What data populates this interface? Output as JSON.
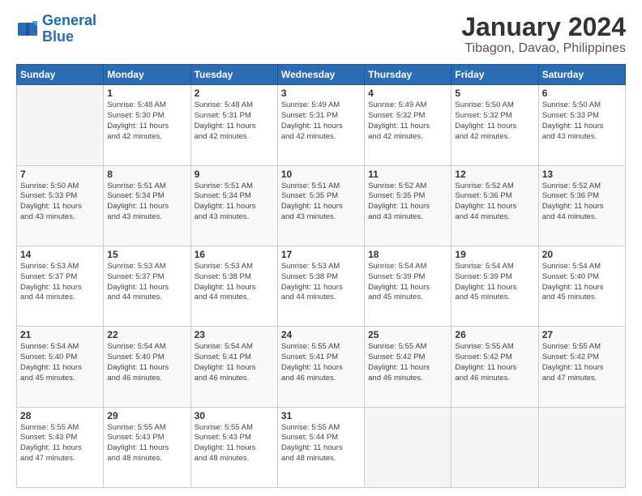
{
  "header": {
    "logo_line1": "General",
    "logo_line2": "Blue",
    "title": "January 2024",
    "subtitle": "Tibagon, Davao, Philippines"
  },
  "weekdays": [
    "Sunday",
    "Monday",
    "Tuesday",
    "Wednesday",
    "Thursday",
    "Friday",
    "Saturday"
  ],
  "weeks": [
    [
      {
        "day": "",
        "info": ""
      },
      {
        "day": "1",
        "info": "Sunrise: 5:48 AM\nSunset: 5:30 PM\nDaylight: 11 hours\nand 42 minutes."
      },
      {
        "day": "2",
        "info": "Sunrise: 5:48 AM\nSunset: 5:31 PM\nDaylight: 11 hours\nand 42 minutes."
      },
      {
        "day": "3",
        "info": "Sunrise: 5:49 AM\nSunset: 5:31 PM\nDaylight: 11 hours\nand 42 minutes."
      },
      {
        "day": "4",
        "info": "Sunrise: 5:49 AM\nSunset: 5:32 PM\nDaylight: 11 hours\nand 42 minutes."
      },
      {
        "day": "5",
        "info": "Sunrise: 5:50 AM\nSunset: 5:32 PM\nDaylight: 11 hours\nand 42 minutes."
      },
      {
        "day": "6",
        "info": "Sunrise: 5:50 AM\nSunset: 5:33 PM\nDaylight: 11 hours\nand 43 minutes."
      }
    ],
    [
      {
        "day": "7",
        "info": "Sunrise: 5:50 AM\nSunset: 5:33 PM\nDaylight: 11 hours\nand 43 minutes."
      },
      {
        "day": "8",
        "info": "Sunrise: 5:51 AM\nSunset: 5:34 PM\nDaylight: 11 hours\nand 43 minutes."
      },
      {
        "day": "9",
        "info": "Sunrise: 5:51 AM\nSunset: 5:34 PM\nDaylight: 11 hours\nand 43 minutes."
      },
      {
        "day": "10",
        "info": "Sunrise: 5:51 AM\nSunset: 5:35 PM\nDaylight: 11 hours\nand 43 minutes."
      },
      {
        "day": "11",
        "info": "Sunrise: 5:52 AM\nSunset: 5:35 PM\nDaylight: 11 hours\nand 43 minutes."
      },
      {
        "day": "12",
        "info": "Sunrise: 5:52 AM\nSunset: 5:36 PM\nDaylight: 11 hours\nand 44 minutes."
      },
      {
        "day": "13",
        "info": "Sunrise: 5:52 AM\nSunset: 5:36 PM\nDaylight: 11 hours\nand 44 minutes."
      }
    ],
    [
      {
        "day": "14",
        "info": "Sunrise: 5:53 AM\nSunset: 5:37 PM\nDaylight: 11 hours\nand 44 minutes."
      },
      {
        "day": "15",
        "info": "Sunrise: 5:53 AM\nSunset: 5:37 PM\nDaylight: 11 hours\nand 44 minutes."
      },
      {
        "day": "16",
        "info": "Sunrise: 5:53 AM\nSunset: 5:38 PM\nDaylight: 11 hours\nand 44 minutes."
      },
      {
        "day": "17",
        "info": "Sunrise: 5:53 AM\nSunset: 5:38 PM\nDaylight: 11 hours\nand 44 minutes."
      },
      {
        "day": "18",
        "info": "Sunrise: 5:54 AM\nSunset: 5:39 PM\nDaylight: 11 hours\nand 45 minutes."
      },
      {
        "day": "19",
        "info": "Sunrise: 5:54 AM\nSunset: 5:39 PM\nDaylight: 11 hours\nand 45 minutes."
      },
      {
        "day": "20",
        "info": "Sunrise: 5:54 AM\nSunset: 5:40 PM\nDaylight: 11 hours\nand 45 minutes."
      }
    ],
    [
      {
        "day": "21",
        "info": "Sunrise: 5:54 AM\nSunset: 5:40 PM\nDaylight: 11 hours\nand 45 minutes."
      },
      {
        "day": "22",
        "info": "Sunrise: 5:54 AM\nSunset: 5:40 PM\nDaylight: 11 hours\nand 46 minutes."
      },
      {
        "day": "23",
        "info": "Sunrise: 5:54 AM\nSunset: 5:41 PM\nDaylight: 11 hours\nand 46 minutes."
      },
      {
        "day": "24",
        "info": "Sunrise: 5:55 AM\nSunset: 5:41 PM\nDaylight: 11 hours\nand 46 minutes."
      },
      {
        "day": "25",
        "info": "Sunrise: 5:55 AM\nSunset: 5:42 PM\nDaylight: 11 hours\nand 46 minutes."
      },
      {
        "day": "26",
        "info": "Sunrise: 5:55 AM\nSunset: 5:42 PM\nDaylight: 11 hours\nand 46 minutes."
      },
      {
        "day": "27",
        "info": "Sunrise: 5:55 AM\nSunset: 5:42 PM\nDaylight: 11 hours\nand 47 minutes."
      }
    ],
    [
      {
        "day": "28",
        "info": "Sunrise: 5:55 AM\nSunset: 5:43 PM\nDaylight: 11 hours\nand 47 minutes."
      },
      {
        "day": "29",
        "info": "Sunrise: 5:55 AM\nSunset: 5:43 PM\nDaylight: 11 hours\nand 48 minutes."
      },
      {
        "day": "30",
        "info": "Sunrise: 5:55 AM\nSunset: 5:43 PM\nDaylight: 11 hours\nand 48 minutes."
      },
      {
        "day": "31",
        "info": "Sunrise: 5:55 AM\nSunset: 5:44 PM\nDaylight: 11 hours\nand 48 minutes."
      },
      {
        "day": "",
        "info": ""
      },
      {
        "day": "",
        "info": ""
      },
      {
        "day": "",
        "info": ""
      }
    ]
  ]
}
